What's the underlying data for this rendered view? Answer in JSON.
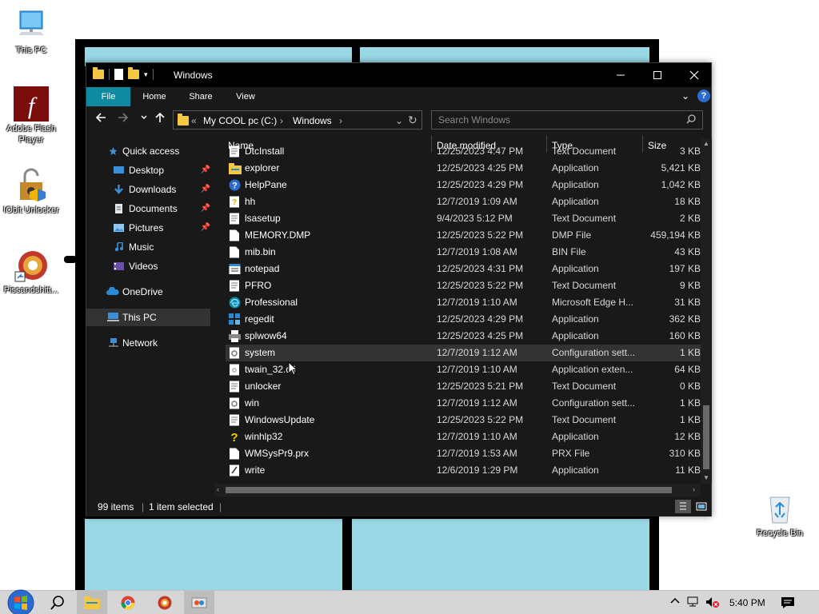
{
  "desktop": {
    "icons": [
      {
        "label": "This PC"
      },
      {
        "label": "Adobe Flash Player"
      },
      {
        "label": "IObit Unlocker"
      },
      {
        "label": "Pissandshitt..."
      },
      {
        "label": "Recycle Bin"
      }
    ]
  },
  "window": {
    "title": "Windows",
    "ribbon_tabs": [
      "File",
      "Home",
      "Share",
      "View"
    ],
    "address": {
      "prefix": "«",
      "segments": [
        "My COOL pc (C:)",
        "Windows"
      ]
    },
    "search_placeholder": "Search Windows",
    "columns": {
      "name": "Name",
      "date": "Date modified",
      "type": "Type",
      "size": "Size"
    },
    "nav": [
      {
        "label": "Quick access",
        "icon": "star-icon"
      },
      {
        "label": "Desktop",
        "icon": "desktop-icon",
        "pinned": true
      },
      {
        "label": "Downloads",
        "icon": "download-icon",
        "pinned": true
      },
      {
        "label": "Documents",
        "icon": "documents-icon",
        "pinned": true
      },
      {
        "label": "Pictures",
        "icon": "pictures-icon",
        "pinned": true
      },
      {
        "label": "Music",
        "icon": "music-icon"
      },
      {
        "label": "Videos",
        "icon": "videos-icon"
      },
      {
        "label": "OneDrive",
        "icon": "cloud-icon"
      },
      {
        "label": "This PC",
        "icon": "computer-icon",
        "selected": true
      },
      {
        "label": "Network",
        "icon": "network-icon"
      }
    ],
    "files": [
      {
        "name": "DtcInstall",
        "date": "12/25/2023 4:47 PM",
        "type": "Text Document",
        "size": "3 KB",
        "icon": "text-file-icon"
      },
      {
        "name": "explorer",
        "date": "12/25/2023 4:25 PM",
        "type": "Application",
        "size": "5,421 KB",
        "icon": "folder-app-icon"
      },
      {
        "name": "HelpPane",
        "date": "12/25/2023 4:29 PM",
        "type": "Application",
        "size": "1,042 KB",
        "icon": "help-icon"
      },
      {
        "name": "hh",
        "date": "12/7/2019 1:09 AM",
        "type": "Application",
        "size": "18 KB",
        "icon": "help-doc-icon"
      },
      {
        "name": "lsasetup",
        "date": "9/4/2023 5:12 PM",
        "type": "Text Document",
        "size": "2 KB",
        "icon": "text-file-icon"
      },
      {
        "name": "MEMORY.DMP",
        "date": "12/25/2023 5:22 PM",
        "type": "DMP File",
        "size": "459,194 KB",
        "icon": "file-icon"
      },
      {
        "name": "mib.bin",
        "date": "12/7/2019 1:08 AM",
        "type": "BIN File",
        "size": "43 KB",
        "icon": "file-icon"
      },
      {
        "name": "notepad",
        "date": "12/25/2023 4:31 PM",
        "type": "Application",
        "size": "197 KB",
        "icon": "notepad-icon"
      },
      {
        "name": "PFRO",
        "date": "12/25/2023 5:22 PM",
        "type": "Text Document",
        "size": "9 KB",
        "icon": "text-file-icon"
      },
      {
        "name": "Professional",
        "date": "12/7/2019 1:10 AM",
        "type": "Microsoft Edge H...",
        "size": "31 KB",
        "icon": "edge-icon"
      },
      {
        "name": "regedit",
        "date": "12/25/2023 4:29 PM",
        "type": "Application",
        "size": "362 KB",
        "icon": "regedit-icon"
      },
      {
        "name": "splwow64",
        "date": "12/25/2023 4:25 PM",
        "type": "Application",
        "size": "160 KB",
        "icon": "printer-icon"
      },
      {
        "name": "system",
        "date": "12/7/2019 1:12 AM",
        "type": "Configuration sett...",
        "size": "1 KB",
        "icon": "config-file-icon"
      },
      {
        "name": "twain_32.dll",
        "date": "12/7/2019 1:10 AM",
        "type": "Application exten...",
        "size": "64 KB",
        "icon": "dll-icon"
      },
      {
        "name": "unlocker",
        "date": "12/25/2023 5:21 PM",
        "type": "Text Document",
        "size": "0 KB",
        "icon": "text-file-icon"
      },
      {
        "name": "win",
        "date": "12/7/2019 1:12 AM",
        "type": "Configuration sett...",
        "size": "1 KB",
        "icon": "config-file-icon"
      },
      {
        "name": "WindowsUpdate",
        "date": "12/25/2023 5:22 PM",
        "type": "Text Document",
        "size": "1 KB",
        "icon": "text-file-icon"
      },
      {
        "name": "winhlp32",
        "date": "12/7/2019 1:10 AM",
        "type": "Application",
        "size": "12 KB",
        "icon": "question-icon"
      },
      {
        "name": "WMSysPr9.prx",
        "date": "12/7/2019 1:53 AM",
        "type": "PRX File",
        "size": "310 KB",
        "icon": "file-icon"
      },
      {
        "name": "write",
        "date": "12/6/2019 1:29 PM",
        "type": "Application",
        "size": "11 KB",
        "icon": "write-icon"
      }
    ],
    "status": {
      "items": "99 items",
      "selected": "1 item selected"
    }
  },
  "taskbar": {
    "clock": "5:40 PM"
  },
  "colors": {
    "accent": "#0f8aa0",
    "window_bg": "#191919",
    "titlebar": "#000000",
    "wallpaper_pane": "#9ad8e6"
  }
}
